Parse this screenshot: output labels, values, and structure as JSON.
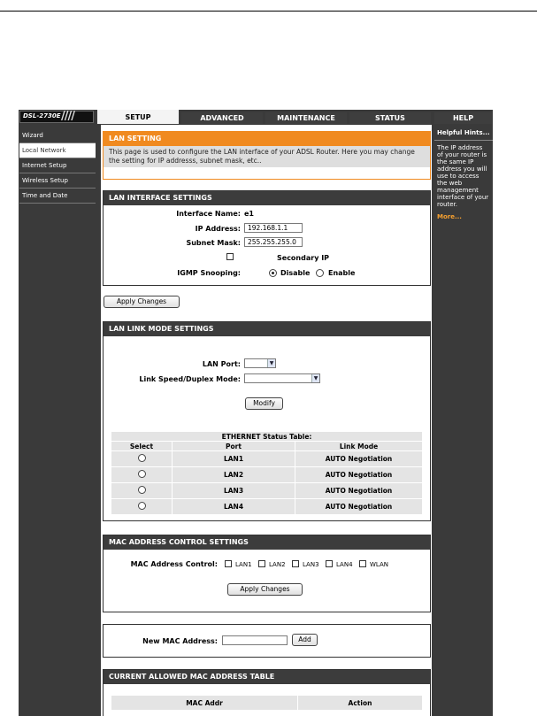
{
  "header": {
    "logo": "DSL-2730E",
    "tabs": [
      {
        "label": "SETUP",
        "active": true
      },
      {
        "label": "ADVANCED",
        "active": false
      },
      {
        "label": "MAINTENANCE",
        "active": false
      },
      {
        "label": "STATUS",
        "active": false
      },
      {
        "label": "HELP",
        "active": false
      }
    ]
  },
  "sidebar": {
    "items": [
      {
        "label": "Wizard",
        "active": false
      },
      {
        "label": "Local Network",
        "active": true
      },
      {
        "label": "Internet Setup",
        "active": false
      },
      {
        "label": "Wireless Setup",
        "active": false
      },
      {
        "label": "Time and Date",
        "active": false
      }
    ]
  },
  "hints": {
    "title": "Helpful Hints...",
    "text": "The IP address of your router is the same IP address you will use to access the web management interface of your router.",
    "more": "More..."
  },
  "lan_setting": {
    "title": "LAN SETTING",
    "description": "This page is used to configure the LAN interface of your ADSL Router. Here you may change the setting for IP addresss, subnet mask, etc.."
  },
  "lan_interface": {
    "title": "LAN INTERFACE SETTINGS",
    "interface_name_label": "Interface Name:",
    "interface_name_value": "e1",
    "ip_label": "IP Address:",
    "ip_value": "192.168.1.1",
    "subnet_label": "Subnet Mask:",
    "subnet_value": "255.255.255.0",
    "secondary_ip_label": "Secondary IP",
    "igmp_label": "IGMP Snooping:",
    "igmp_disable": "Disable",
    "igmp_enable": "Enable",
    "igmp_selected": "Disable"
  },
  "apply_changes": "Apply Changes",
  "lan_link": {
    "title": "LAN LINK MODE SETTINGS",
    "lan_port_label": "LAN Port:",
    "lan_port_value": "",
    "speed_label": "Link Speed/Duplex Mode:",
    "speed_value": "",
    "modify": "Modify",
    "table_title": "ETHERNET Status Table:",
    "columns": [
      "Select",
      "Port",
      "Link Mode"
    ],
    "rows": [
      {
        "port": "LAN1",
        "mode": "AUTO Negotiation"
      },
      {
        "port": "LAN2",
        "mode": "AUTO Negotiation"
      },
      {
        "port": "LAN3",
        "mode": "AUTO Negotiation"
      },
      {
        "port": "LAN4",
        "mode": "AUTO Negotiation"
      }
    ]
  },
  "mac_control": {
    "title": "MAC ADDRESS CONTROL SETTINGS",
    "label": "MAC Address Control:",
    "options": [
      "LAN1",
      "LAN2",
      "LAN3",
      "LAN4",
      "WLAN"
    ],
    "apply": "Apply Changes"
  },
  "new_mac": {
    "label": "New MAC Address:",
    "value": "",
    "add": "Add"
  },
  "allowed_table": {
    "title": "CURRENT ALLOWED MAC ADDRESS TABLE",
    "columns": [
      "MAC Addr",
      "Action"
    ]
  }
}
